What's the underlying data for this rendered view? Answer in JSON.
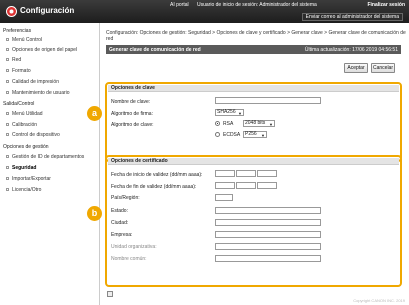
{
  "header": {
    "app_title": "Configuración",
    "portal": "AI portal",
    "session": "Usuario de inicio de sesión: Administrador del sistema",
    "logout": "Finalizar sesión",
    "mail": "Enviar correo al administrador del sistema"
  },
  "sidebar": {
    "sections": [
      {
        "title": "Preferencias",
        "items": [
          "Menú Control",
          "Opciones de origen del papel",
          "Red",
          "Formato",
          "Calidad de impresión",
          "Mantenimiento de usuario"
        ]
      },
      {
        "title": "Salida/Control",
        "items": [
          "Menú Utilidad",
          "Calibración",
          "Control de dispositivo"
        ]
      },
      {
        "title": "Opciones de gestión",
        "items": [
          "Gestión de ID de departamentos",
          "Seguridad",
          "Importar/Exportar",
          "Licencia/Otro"
        ]
      }
    ]
  },
  "main": {
    "breadcrumb": "Configuración: Opciones de gestión: Seguridad > Opciones de clave y certificado > Generar clave > Generar clave de comunicación de red",
    "title": "Generar clave de comunicación de red",
    "last_update": "Última actualización: 17/06 2019 04:56:51",
    "accept": "Aceptar",
    "cancel": "Cancelar"
  },
  "key_options": {
    "heading": "Opciones de clave",
    "name_label": "Nombre de clave:",
    "sig_label": "Algoritmo de firma:",
    "sig_value": "SHA256",
    "key_alg_label": "Algoritmo de clave:",
    "rsa_label": "RSA",
    "rsa_value": "2048 bits",
    "ecdsa_label": "ECDSA",
    "ecdsa_value": "P256"
  },
  "cert_options": {
    "heading": "Opciones de certificado",
    "start_label": "Fecha de inicio de validez (dd/mm aaaa):",
    "end_label": "Fecha de fin de validez (dd/mm aaaa):",
    "country_label": "País/Región:",
    "state_label": "Estado:",
    "city_label": "Ciudad:",
    "company_label": "Empresa:",
    "unit_label": "Unidad organizativa:",
    "common_label": "Nombre común:"
  },
  "badges": {
    "a": "a",
    "b": "b"
  },
  "footer": {
    "copyright": "Copyright CANON INC. 2019"
  }
}
